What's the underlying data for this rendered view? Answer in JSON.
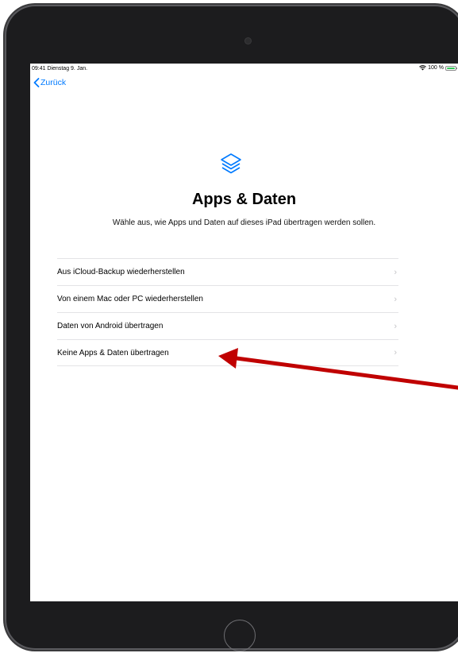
{
  "status_bar": {
    "time_date": "09:41  Dienstag 9. Jan.",
    "battery": "100 %",
    "battery_level": 1.0
  },
  "nav": {
    "back_label": "Zurück"
  },
  "header": {
    "icon": "stacked-layers-icon",
    "title": "Apps & Daten",
    "subtitle": "Wähle aus, wie Apps und Daten auf dieses iPad übertragen werden sollen."
  },
  "options": [
    {
      "label": "Aus iCloud-Backup wiederherstellen"
    },
    {
      "label": "Von einem Mac oder PC wiederherstellen"
    },
    {
      "label": "Daten von Android übertragen"
    },
    {
      "label": "Keine Apps & Daten übertragen"
    }
  ],
  "colors": {
    "accent": "#007aff",
    "annotation_arrow": "#c00000",
    "battery": "#34c759"
  }
}
